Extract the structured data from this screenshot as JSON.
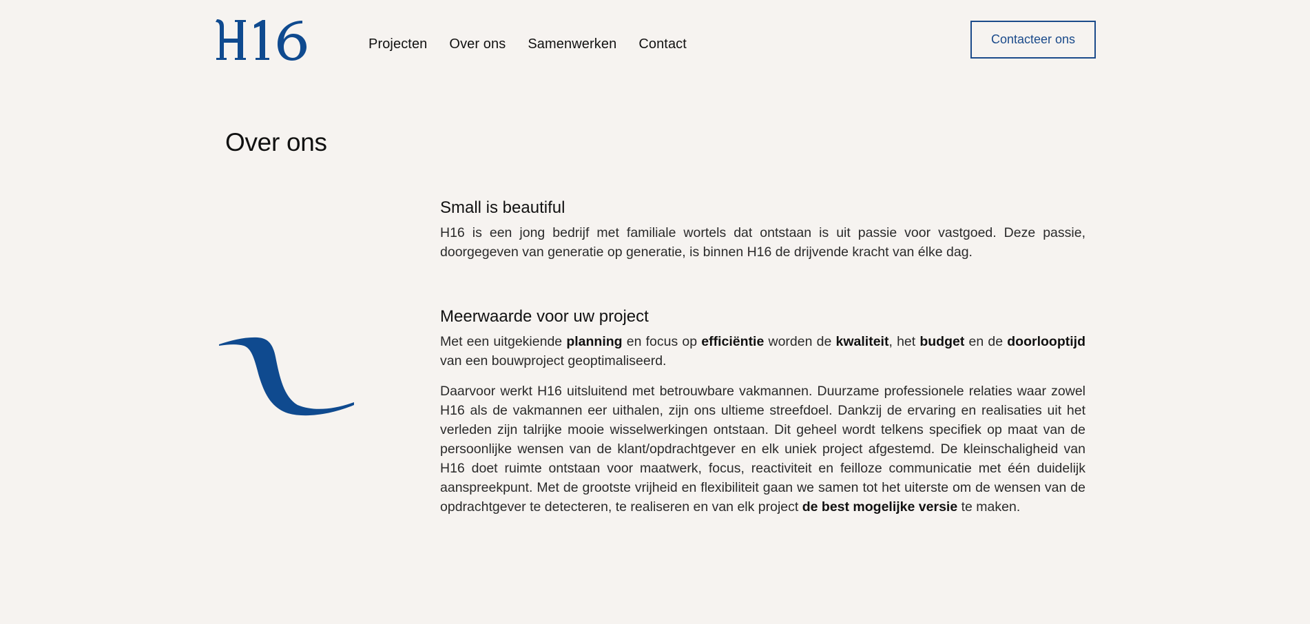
{
  "brand": {
    "logo_text": "H16",
    "accent_color": "#0f4a8f"
  },
  "nav": {
    "items": [
      {
        "label": "Projecten"
      },
      {
        "label": "Over ons"
      },
      {
        "label": "Samenwerken"
      },
      {
        "label": "Contact"
      }
    ],
    "cta_label": "Contacteer ons"
  },
  "page": {
    "title": "Over ons"
  },
  "sections": [
    {
      "heading": "Small is beautiful",
      "paragraphs": [
        [
          {
            "text": "H16 is een jong bedrijf met familiale wortels dat ontstaan is uit passie voor vastgoed. Deze passie, doorgegeven van generatie op generatie, is binnen H16 de drijvende kracht van élke dag.",
            "bold": false
          }
        ]
      ]
    },
    {
      "heading": "Meerwaarde voor uw project",
      "paragraphs": [
        [
          {
            "text": "Met een uitgekiende ",
            "bold": false
          },
          {
            "text": "planning",
            "bold": true
          },
          {
            "text": " en focus op ",
            "bold": false
          },
          {
            "text": "efficiëntie",
            "bold": true
          },
          {
            "text": " worden de ",
            "bold": false
          },
          {
            "text": "kwaliteit",
            "bold": true
          },
          {
            "text": ", het ",
            "bold": false
          },
          {
            "text": "budget",
            "bold": true
          },
          {
            "text": " en de ",
            "bold": false
          },
          {
            "text": "doorlooptijd",
            "bold": true
          },
          {
            "text": " van een bouwproject geoptimaliseerd.",
            "bold": false
          }
        ],
        [
          {
            "text": "Daarvoor werkt H16 uitsluitend met betrouwbare vakmannen. Duurzame professionele relaties waar zowel H16 als de vakmannen eer uithalen, zijn ons ultieme streefdoel. Dankzij de ervaring en realisaties uit het verleden zijn talrijke mooie wisselwerkingen ontstaan. Dit geheel wordt telkens specifiek op maat van de persoonlijke wensen van de klant/opdrachtgever en elk uniek project afgestemd. De kleinschaligheid van H16 doet ruimte ontstaan voor maatwerk, focus, reactiviteit en feilloze communicatie met één duidelijk aanspreekpunt. Met de grootste vrijheid en flexibiliteit gaan we samen tot het uiterste om de wensen van de opdrachtgever te detecteren, te realiseren en van elk project ",
            "bold": false
          },
          {
            "text": "de best mogelijke versie",
            "bold": true
          },
          {
            "text": " te maken.",
            "bold": false
          }
        ]
      ]
    }
  ]
}
